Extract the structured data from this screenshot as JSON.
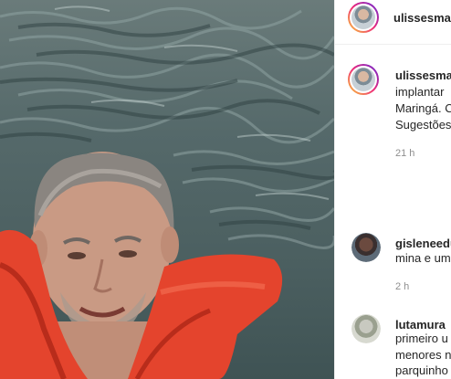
{
  "post": {
    "author": "ulissesmai",
    "photo_alt": "man swimming in lake wearing orange life vest"
  },
  "caption": {
    "author": "ulissesma",
    "lines": [
      "implantar",
      "Maringá. C",
      "Sugestões"
    ],
    "time": "21 h"
  },
  "comments": [
    {
      "author": "gisleneedu",
      "lines": [
        "mina e um"
      ],
      "time": "2 h"
    },
    {
      "author": "lutamura",
      "lines": [
        "primeiro u",
        "menores n",
        "parquinho"
      ]
    }
  ],
  "colors": {
    "ring_start": "#f9ce34",
    "ring_mid": "#ee2a7b",
    "ring_end": "#6228d7",
    "vest": "#e8412a",
    "water": "#55696a"
  },
  "icons": {
    "header_avatar": "profile-avatar-icon",
    "caption_avatar": "profile-avatar-icon",
    "commenter_avatar": "commenter-avatar-icon"
  }
}
